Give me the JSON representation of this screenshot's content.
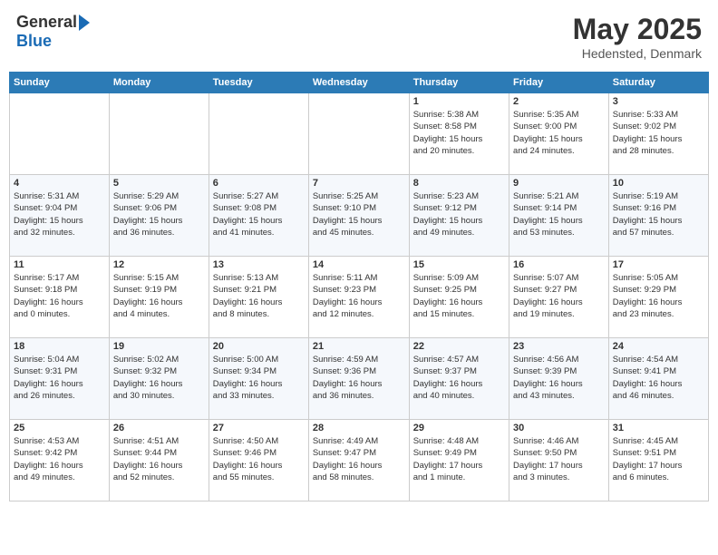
{
  "header": {
    "logo_general": "General",
    "logo_blue": "Blue",
    "month_title": "May 2025",
    "location": "Hedensted, Denmark"
  },
  "columns": [
    "Sunday",
    "Monday",
    "Tuesday",
    "Wednesday",
    "Thursday",
    "Friday",
    "Saturday"
  ],
  "weeks": [
    [
      {
        "day": "",
        "info": ""
      },
      {
        "day": "",
        "info": ""
      },
      {
        "day": "",
        "info": ""
      },
      {
        "day": "",
        "info": ""
      },
      {
        "day": "1",
        "info": "Sunrise: 5:38 AM\nSunset: 8:58 PM\nDaylight: 15 hours\nand 20 minutes."
      },
      {
        "day": "2",
        "info": "Sunrise: 5:35 AM\nSunset: 9:00 PM\nDaylight: 15 hours\nand 24 minutes."
      },
      {
        "day": "3",
        "info": "Sunrise: 5:33 AM\nSunset: 9:02 PM\nDaylight: 15 hours\nand 28 minutes."
      }
    ],
    [
      {
        "day": "4",
        "info": "Sunrise: 5:31 AM\nSunset: 9:04 PM\nDaylight: 15 hours\nand 32 minutes."
      },
      {
        "day": "5",
        "info": "Sunrise: 5:29 AM\nSunset: 9:06 PM\nDaylight: 15 hours\nand 36 minutes."
      },
      {
        "day": "6",
        "info": "Sunrise: 5:27 AM\nSunset: 9:08 PM\nDaylight: 15 hours\nand 41 minutes."
      },
      {
        "day": "7",
        "info": "Sunrise: 5:25 AM\nSunset: 9:10 PM\nDaylight: 15 hours\nand 45 minutes."
      },
      {
        "day": "8",
        "info": "Sunrise: 5:23 AM\nSunset: 9:12 PM\nDaylight: 15 hours\nand 49 minutes."
      },
      {
        "day": "9",
        "info": "Sunrise: 5:21 AM\nSunset: 9:14 PM\nDaylight: 15 hours\nand 53 minutes."
      },
      {
        "day": "10",
        "info": "Sunrise: 5:19 AM\nSunset: 9:16 PM\nDaylight: 15 hours\nand 57 minutes."
      }
    ],
    [
      {
        "day": "11",
        "info": "Sunrise: 5:17 AM\nSunset: 9:18 PM\nDaylight: 16 hours\nand 0 minutes."
      },
      {
        "day": "12",
        "info": "Sunrise: 5:15 AM\nSunset: 9:19 PM\nDaylight: 16 hours\nand 4 minutes."
      },
      {
        "day": "13",
        "info": "Sunrise: 5:13 AM\nSunset: 9:21 PM\nDaylight: 16 hours\nand 8 minutes."
      },
      {
        "day": "14",
        "info": "Sunrise: 5:11 AM\nSunset: 9:23 PM\nDaylight: 16 hours\nand 12 minutes."
      },
      {
        "day": "15",
        "info": "Sunrise: 5:09 AM\nSunset: 9:25 PM\nDaylight: 16 hours\nand 15 minutes."
      },
      {
        "day": "16",
        "info": "Sunrise: 5:07 AM\nSunset: 9:27 PM\nDaylight: 16 hours\nand 19 minutes."
      },
      {
        "day": "17",
        "info": "Sunrise: 5:05 AM\nSunset: 9:29 PM\nDaylight: 16 hours\nand 23 minutes."
      }
    ],
    [
      {
        "day": "18",
        "info": "Sunrise: 5:04 AM\nSunset: 9:31 PM\nDaylight: 16 hours\nand 26 minutes."
      },
      {
        "day": "19",
        "info": "Sunrise: 5:02 AM\nSunset: 9:32 PM\nDaylight: 16 hours\nand 30 minutes."
      },
      {
        "day": "20",
        "info": "Sunrise: 5:00 AM\nSunset: 9:34 PM\nDaylight: 16 hours\nand 33 minutes."
      },
      {
        "day": "21",
        "info": "Sunrise: 4:59 AM\nSunset: 9:36 PM\nDaylight: 16 hours\nand 36 minutes."
      },
      {
        "day": "22",
        "info": "Sunrise: 4:57 AM\nSunset: 9:37 PM\nDaylight: 16 hours\nand 40 minutes."
      },
      {
        "day": "23",
        "info": "Sunrise: 4:56 AM\nSunset: 9:39 PM\nDaylight: 16 hours\nand 43 minutes."
      },
      {
        "day": "24",
        "info": "Sunrise: 4:54 AM\nSunset: 9:41 PM\nDaylight: 16 hours\nand 46 minutes."
      }
    ],
    [
      {
        "day": "25",
        "info": "Sunrise: 4:53 AM\nSunset: 9:42 PM\nDaylight: 16 hours\nand 49 minutes."
      },
      {
        "day": "26",
        "info": "Sunrise: 4:51 AM\nSunset: 9:44 PM\nDaylight: 16 hours\nand 52 minutes."
      },
      {
        "day": "27",
        "info": "Sunrise: 4:50 AM\nSunset: 9:46 PM\nDaylight: 16 hours\nand 55 minutes."
      },
      {
        "day": "28",
        "info": "Sunrise: 4:49 AM\nSunset: 9:47 PM\nDaylight: 16 hours\nand 58 minutes."
      },
      {
        "day": "29",
        "info": "Sunrise: 4:48 AM\nSunset: 9:49 PM\nDaylight: 17 hours\nand 1 minute."
      },
      {
        "day": "30",
        "info": "Sunrise: 4:46 AM\nSunset: 9:50 PM\nDaylight: 17 hours\nand 3 minutes."
      },
      {
        "day": "31",
        "info": "Sunrise: 4:45 AM\nSunset: 9:51 PM\nDaylight: 17 hours\nand 6 minutes."
      }
    ]
  ]
}
